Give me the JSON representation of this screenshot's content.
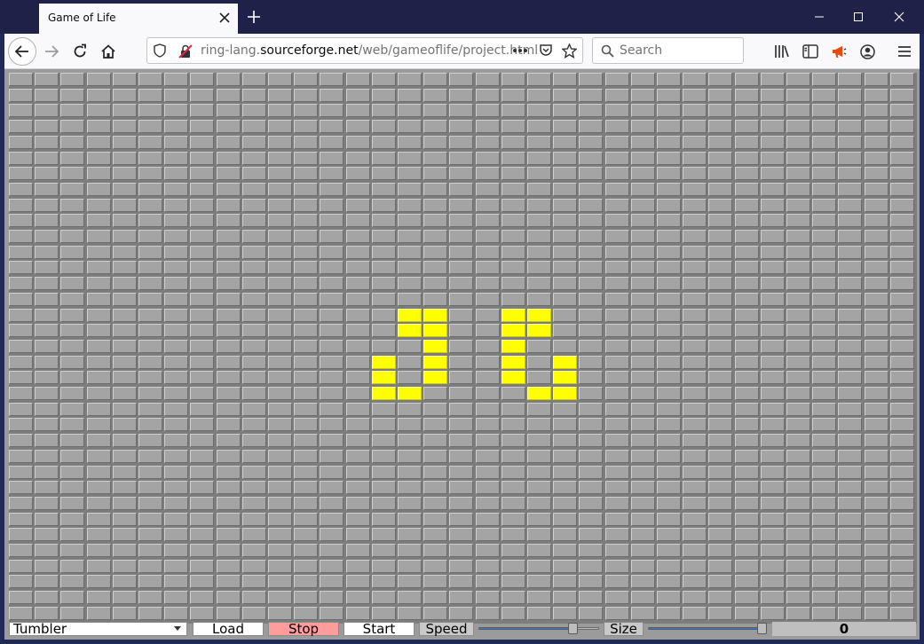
{
  "browser": {
    "tab": {
      "title": "Game of Life"
    },
    "url": {
      "prefix": "ring-lang.",
      "domain": "sourceforge.net",
      "path": "/web/gameoflife/project.html"
    },
    "search": {
      "placeholder": "Search"
    }
  },
  "colors": {
    "alive": "#ffff00",
    "dead": "#a4a4a4",
    "stop_button": "#ff9c9c",
    "titlebar": "#1f2149"
  },
  "grid": {
    "cols": 35,
    "rows": 35,
    "alive_cells": [
      [
        15,
        15
      ],
      [
        15,
        16
      ],
      [
        15,
        19
      ],
      [
        15,
        20
      ],
      [
        16,
        15
      ],
      [
        16,
        16
      ],
      [
        16,
        19
      ],
      [
        16,
        20
      ],
      [
        17,
        16
      ],
      [
        17,
        19
      ],
      [
        18,
        14
      ],
      [
        18,
        16
      ],
      [
        18,
        19
      ],
      [
        18,
        21
      ],
      [
        19,
        14
      ],
      [
        19,
        16
      ],
      [
        19,
        19
      ],
      [
        19,
        21
      ],
      [
        20,
        14
      ],
      [
        20,
        15
      ],
      [
        20,
        20
      ],
      [
        20,
        21
      ]
    ]
  },
  "controls": {
    "pattern_select": {
      "value": "Tumbler"
    },
    "load_label": "Load",
    "stop_label": "Stop",
    "start_label": "Start",
    "speed_label": "Speed",
    "speed_value": 0.8,
    "size_label": "Size",
    "size_value": 1.0,
    "generation_counter": "0"
  }
}
